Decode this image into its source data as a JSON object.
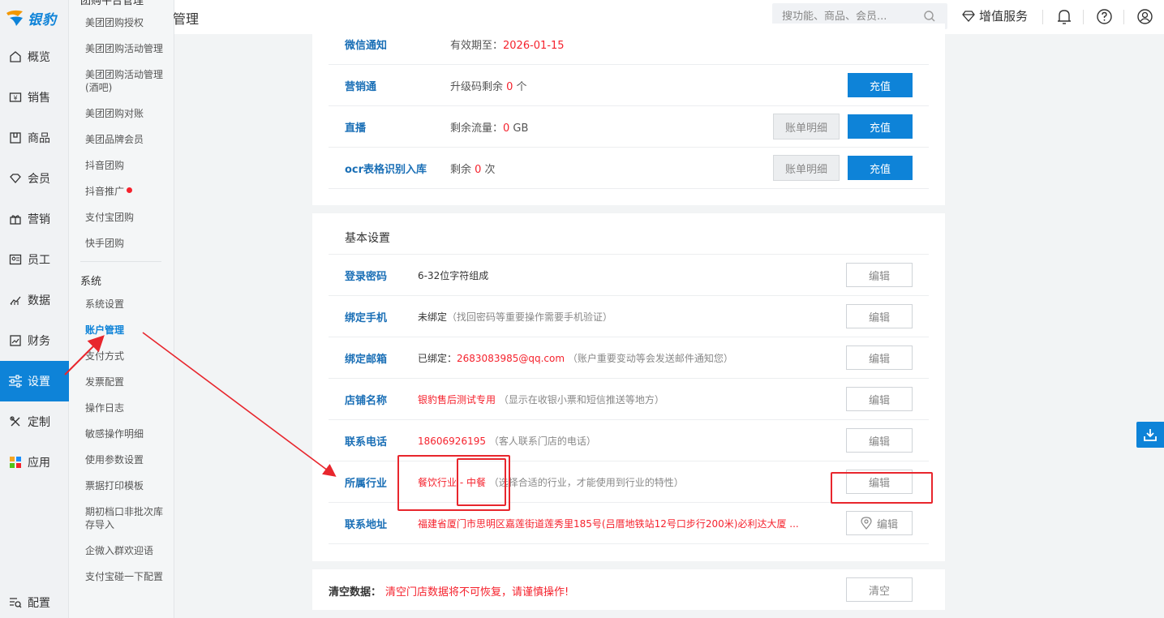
{
  "brand": {
    "name": "银豹",
    "accent": "#0e83d8",
    "danger": "#f5222d"
  },
  "nav": [
    {
      "label": "概览",
      "icon": "home-icon"
    },
    {
      "label": "销售",
      "icon": "sales-icon"
    },
    {
      "label": "商品",
      "icon": "product-icon"
    },
    {
      "label": "会员",
      "icon": "member-icon"
    },
    {
      "label": "营销",
      "icon": "marketing-icon"
    },
    {
      "label": "员工",
      "icon": "staff-icon"
    },
    {
      "label": "数据",
      "icon": "data-icon"
    },
    {
      "label": "财务",
      "icon": "finance-icon"
    },
    {
      "label": "设置",
      "icon": "settings-icon"
    },
    {
      "label": "定制",
      "icon": "custom-icon"
    },
    {
      "label": "应用",
      "icon": "apps-icon"
    }
  ],
  "nav_bottom": {
    "label": "配置",
    "icon": "config-icon"
  },
  "subnav": {
    "group_top": "团购平台管理",
    "top_items": [
      "美团团购授权",
      "美团团购活动管理",
      "美团团购活动管理(酒吧)",
      "美团团购对账",
      "美团品牌会员",
      "抖音团购",
      "抖音推广",
      "支付宝团购",
      "快手团购"
    ],
    "group_system": "系统",
    "system_items": [
      "系统设置",
      "账户管理",
      "支付方式",
      "发票配置",
      "操作日志",
      "敏感操作明细",
      "使用参数设置",
      "票据打印模板",
      "期初档口非批次库存导入",
      "企微入群欢迎语",
      "支付宝碰一下配置"
    ]
  },
  "topbar": {
    "breadcrumb": "账户管理",
    "search_placeholder": "搜功能、商品、会员...",
    "vip_label": "增值服务"
  },
  "services": [
    {
      "name": "微信通知",
      "pre": "有效期至：",
      "value": "2026-01-15",
      "post": "",
      "detail_btn": "",
      "charge_btn": ""
    },
    {
      "name": "营销通",
      "pre": "升级码剩余 ",
      "value": "0",
      "post": " 个",
      "detail_btn": "",
      "charge_btn": "充值"
    },
    {
      "name": "直播",
      "pre": "剩余流量：",
      "value": "0",
      "post": " GB",
      "detail_btn": "账单明细",
      "charge_btn": "充值"
    },
    {
      "name": "ocr表格识别入库",
      "pre": "剩余 ",
      "value": "0",
      "post": " 次",
      "detail_btn": "账单明细",
      "charge_btn": "充值"
    }
  ],
  "basic": {
    "title": "基本设置",
    "edit_label": "编辑",
    "rows": [
      {
        "label": "登录密码",
        "value": "6-32位字符组成",
        "value_red": "",
        "hint": ""
      },
      {
        "label": "绑定手机",
        "value": "未绑定",
        "value_red": "",
        "hint": "（找回密码等重要操作需要手机验证）"
      },
      {
        "label": "绑定邮箱",
        "value": "已绑定：",
        "value_red": "2683083985@qq.com",
        "hint": "（账户重要变动等会发送邮件通知您）"
      },
      {
        "label": "店铺名称",
        "value": "",
        "value_red": "银豹售后测试专用",
        "hint": "（显示在收银小票和短信推送等地方）"
      },
      {
        "label": "联系电话",
        "value": "",
        "value_red": "18606926195",
        "hint": "（客人联系门店的电话）"
      },
      {
        "label": "所属行业",
        "value": "",
        "value_red": "餐饮行业 - 中餐",
        "hint": "（选择合适的行业，才能使用到行业的特性）"
      },
      {
        "label": "联系地址",
        "value": "",
        "value_red": "福建省厦门市思明区嘉莲街道莲秀里185号(吕厝地铁站12号口步行200米)必利达大厦 ...",
        "hint": ""
      }
    ]
  },
  "clear": {
    "label": "清空数据：",
    "warning": "清空门店数据将不可恢复，请谨慎操作!",
    "button": "清空"
  }
}
